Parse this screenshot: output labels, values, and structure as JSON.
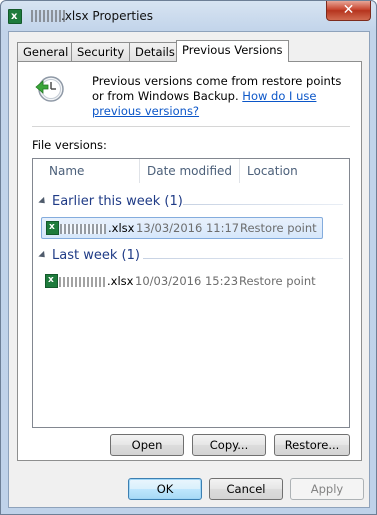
{
  "window": {
    "title": ".xlsx Properties",
    "close_glyph": "✕",
    "app_icon": "excel-file-icon"
  },
  "tabs": [
    {
      "label": "General",
      "active": false
    },
    {
      "label": "Security",
      "active": false
    },
    {
      "label": "Details",
      "active": false
    },
    {
      "label": "Previous Versions",
      "active": true
    }
  ],
  "previous_versions": {
    "description": "Previous versions come from restore points or from Windows Backup. ",
    "help_link": "How do I use previous versions?",
    "file_versions_label": "File versions:",
    "columns": [
      "Name",
      "Date modified",
      "Location"
    ],
    "groups": [
      {
        "title": "Earlier this week (1)",
        "items": [
          {
            "name": ".xlsx",
            "date_modified": "13/03/2016 11:17",
            "location": "Restore point",
            "selected": true
          }
        ]
      },
      {
        "title": "Last week (1)",
        "items": [
          {
            "name": ".xlsx",
            "date_modified": "10/03/2016 15:23",
            "location": "Restore point",
            "selected": false
          }
        ]
      }
    ],
    "buttons": {
      "open": "Open",
      "copy": "Copy...",
      "restore": "Restore..."
    }
  },
  "dialog_buttons": {
    "ok": "OK",
    "cancel": "Cancel",
    "apply": "Apply"
  },
  "colors": {
    "selection_border": "#84acdd",
    "link": "#0b56c8",
    "group_title": "#1f3b86"
  }
}
